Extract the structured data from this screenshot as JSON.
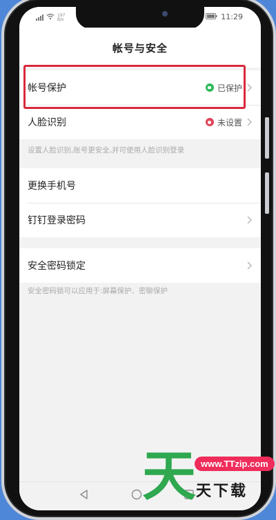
{
  "status": {
    "net_speed": "197\nB/s",
    "time": "11:29"
  },
  "header": {
    "title": "帐号与安全"
  },
  "section1": {
    "rows": [
      {
        "label": "帐号保护",
        "status": "已保护",
        "status_color": "#2fba5a"
      },
      {
        "label": "人脸识别",
        "status": "未设置",
        "status_color": "#e0445a"
      }
    ],
    "hint": "设置人脸识别,账号更安全,并可使用人脸识别登录"
  },
  "section2": {
    "rows": [
      {
        "label": "更换手机号"
      },
      {
        "label": "钉钉登录密码"
      }
    ]
  },
  "section3": {
    "rows": [
      {
        "label": "安全密码锁定"
      }
    ],
    "hint": "安全密码锁可以应用于:屏幕保护、密聊保护"
  },
  "watermark": {
    "big_char": "天",
    "url": "www.TTzip.com",
    "sub": "天下载"
  },
  "colors": {
    "highlight": "#d9283b",
    "background": "#4f87d8",
    "watermark_green": "#2fa84f",
    "watermark_pink": "#ef2c5a"
  },
  "icons": [
    "signal-icon",
    "wifi-icon",
    "eye-icon",
    "bluetooth-icon",
    "battery-icon",
    "chevron-right-icon",
    "back-icon",
    "home-icon",
    "recent-apps-icon"
  ]
}
